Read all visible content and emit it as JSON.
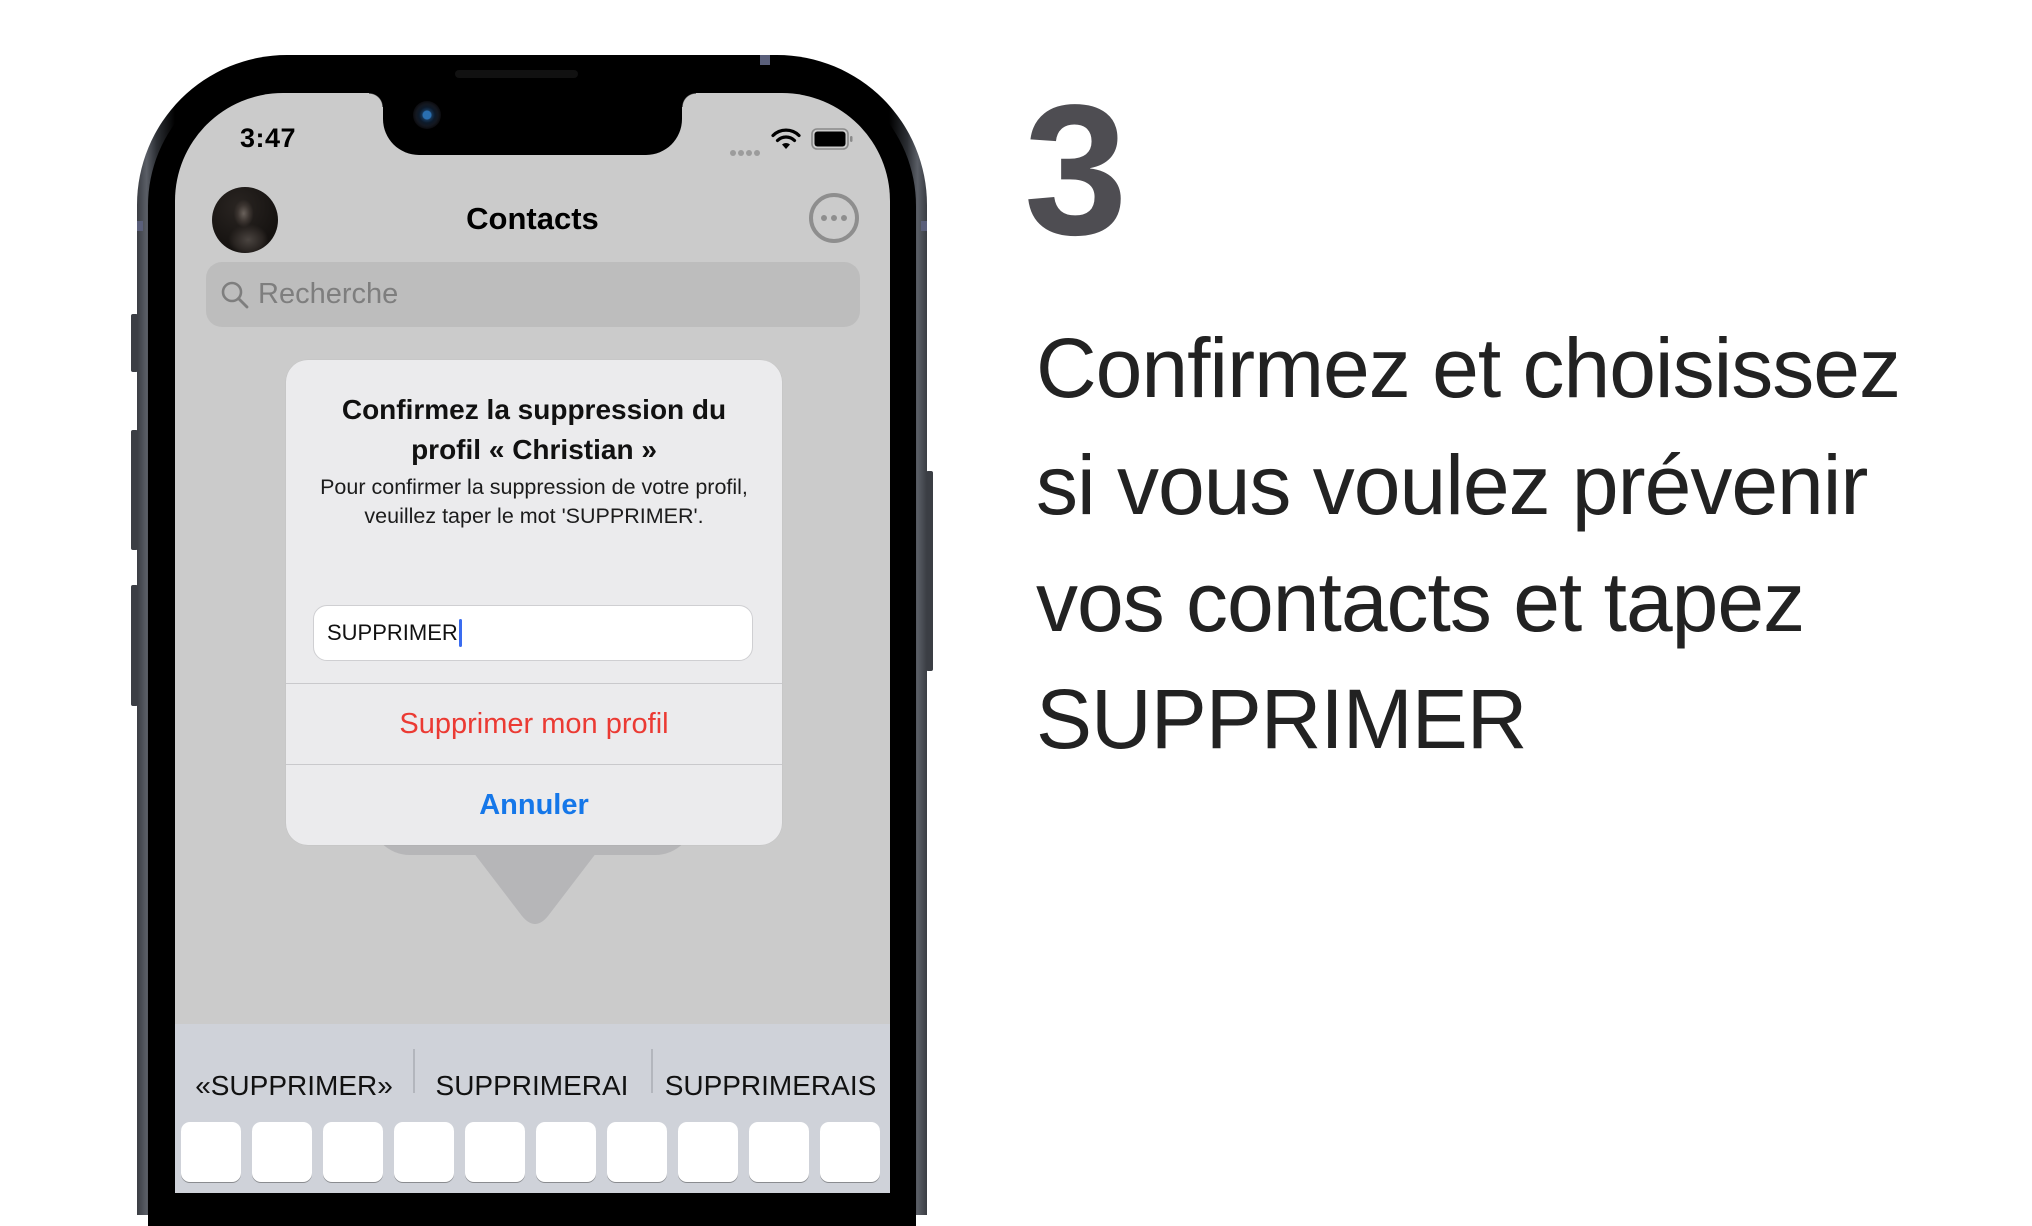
{
  "phone": {
    "status_bar": {
      "time": "3:47",
      "signal_icon": "cellular-signal-dots-icon",
      "wifi_icon": "wifi-icon",
      "battery_icon": "battery-full-icon"
    },
    "header": {
      "title": "Contacts",
      "avatar": "user-avatar-photo",
      "more_icon": "ellipsis-circle-icon"
    },
    "search": {
      "placeholder": "Recherche",
      "icon": "search-icon"
    },
    "alert": {
      "title": "Confirmez la suppression du profil « Christian »",
      "message": "Pour confirmer la suppression de votre profil, veuillez taper le mot 'SUPPRIMER'.",
      "input_value": "SUPPRIMER",
      "actions": [
        {
          "label": "Supprimer mon profil",
          "style": "destructive",
          "color": "#eb3a33"
        },
        {
          "label": "Annuler",
          "style": "cancel",
          "color": "#1577e9"
        }
      ]
    },
    "keyboard": {
      "suggestions": [
        "«SUPPRIMER»",
        "SUPPRIMERAI",
        "SUPPRIMERAIS"
      ]
    }
  },
  "caption": {
    "step_number": "3",
    "text": "Confirmez et choisissez si vous voulez prévenir vos contacts et tapez SUPPRIMER",
    "lines": [
      "Confirmez et choisissez",
      "si vous voulez prévenir",
      "vos contacts et tapez",
      "SUPPRIMER"
    ]
  },
  "colors": {
    "destructive": "#eb3a33",
    "accent": "#1577e9",
    "step_number": "#4e4d52"
  }
}
